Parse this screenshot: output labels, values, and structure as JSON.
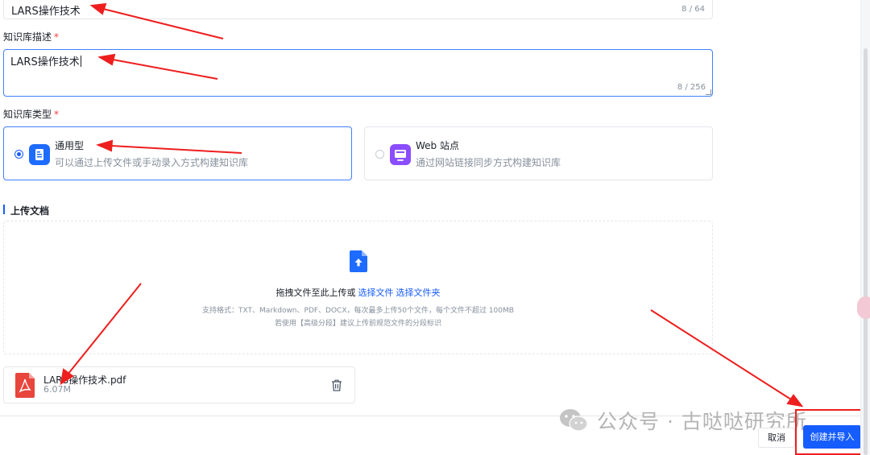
{
  "form": {
    "name_field": {
      "value": "LARS操作技术",
      "counter": "8 / 64"
    },
    "description": {
      "label": "知识库描述",
      "required_mark": "*",
      "value": "LARS操作技术",
      "counter": "8 / 256"
    },
    "type": {
      "label": "知识库类型",
      "required_mark": "*",
      "options": [
        {
          "title": "通用型",
          "desc": "可以通过上传文件或手动录入方式构建知识库",
          "selected": true
        },
        {
          "title": "Web 站点",
          "desc": "通过网站链接同步方式构建知识库",
          "selected": false
        }
      ]
    }
  },
  "upload": {
    "section_title": "上传文档",
    "drop_text": "拖拽文件至此上传或",
    "select_file_link": "选择文件",
    "select_folder_link": "选择文件夹",
    "hint_formats": "支持格式：TXT、Markdown、PDF、DOCX，每次最多上传50个文件，每个文件不超过 100MB",
    "hint_advanced": "若使用【高级分段】建议上传前规范文件的分段标识",
    "files": [
      {
        "name": "LARS操作技术.pdf",
        "size": "6.07M"
      }
    ]
  },
  "footer": {
    "cancel_label": "取消",
    "create_label": "创建并导入"
  },
  "watermark": {
    "text": "公众号 · 古哒哒研究所"
  },
  "colors": {
    "primary": "#165dff",
    "annotation": "#ee1e1e",
    "border": "#e5e6eb"
  }
}
